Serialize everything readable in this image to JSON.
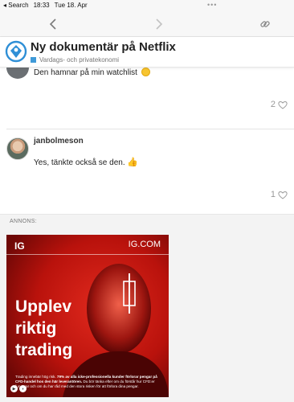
{
  "status_bar": {
    "back_app": "Search",
    "time": "18:33",
    "date": "Tue 18. Apr",
    "menu_dots": "•••"
  },
  "toolbar": {
    "back_icon": "chevron-left-icon",
    "forward_icon": "chevron-right-icon",
    "share_icon": "link-icon"
  },
  "topic": {
    "title": "Ny dokumentär på Netflix",
    "category": "Vardags- och privatekonomi",
    "category_color": "#3f9ad8"
  },
  "posts": [
    {
      "text": "Den hamnar på min watchlist",
      "emoji": "slightly-smiling-face",
      "likes": "2"
    },
    {
      "username": "janbolmeson",
      "text": "Yes, tänkte också se den.",
      "emoji": "thumbs-up",
      "likes": "1"
    }
  ],
  "ad": {
    "label": "ANNONS:",
    "brand": "IG",
    "url": "IG.COM",
    "headline": [
      "Upplev",
      "riktig",
      "trading"
    ],
    "disclaimer_part1": "Trading innebär hög risk. ",
    "disclaimer_bold": "79% av alla icke-professionella kunder förlorar pengar på CFD-handel hos den här leverantören.",
    "disclaimer_part2": " Du bör tänka efter om du förstår hur CFD:er fungerar och om du har råd med den stora risken för att förlora dina pengar.",
    "accent_color": "#c8140e"
  }
}
